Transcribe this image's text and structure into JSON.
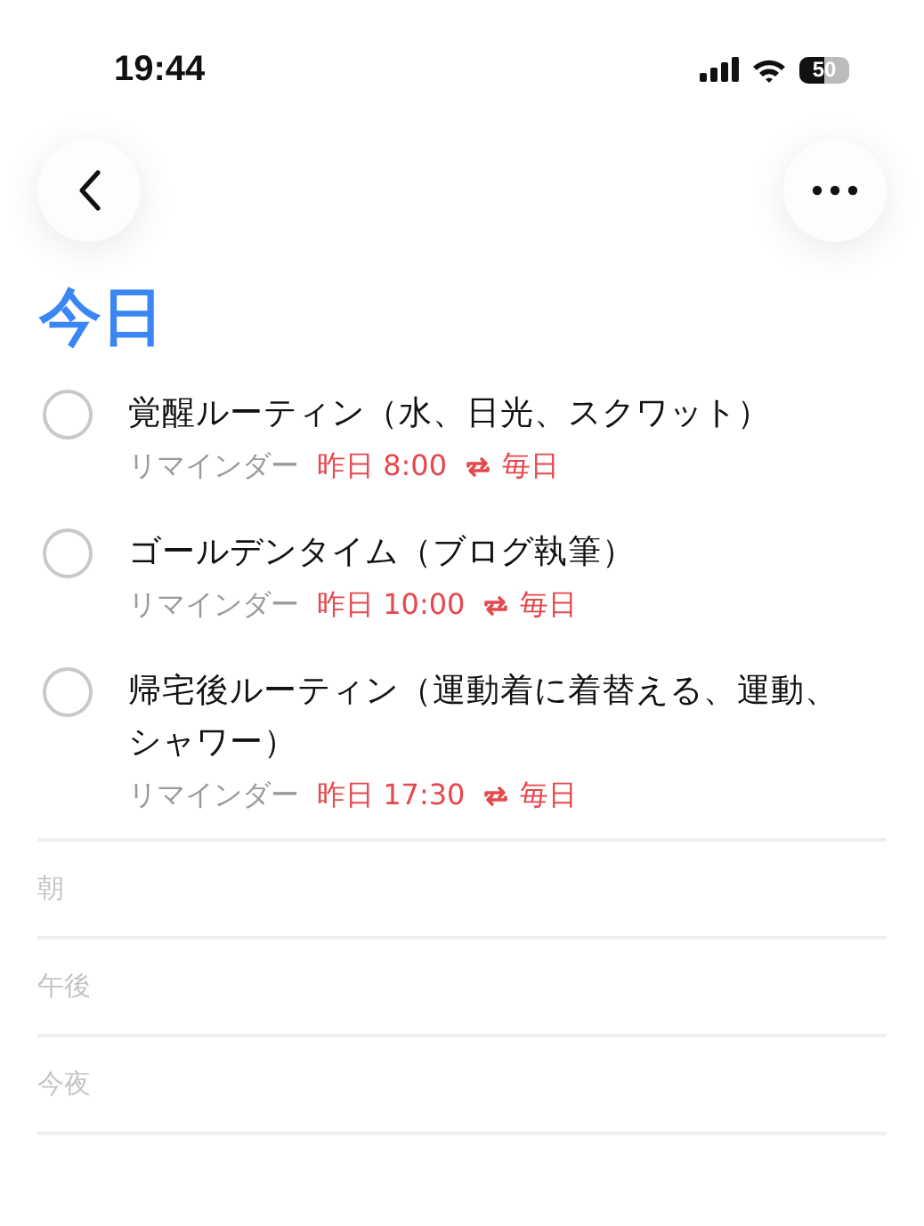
{
  "status_bar": {
    "time": "19:44",
    "battery": "50"
  },
  "title": "今日",
  "reminders": [
    {
      "title": "覚醒ルーティン（水、日光、スクワット）",
      "completed": false,
      "label": "リマインダー",
      "when": "昨日 8:00",
      "repeat": "毎日"
    },
    {
      "title": "ゴールデンタイム（ブログ執筆）",
      "completed": false,
      "label": "リマインダー",
      "when": "昨日 10:00",
      "repeat": "毎日"
    },
    {
      "title": "帰宅後ルーティン（運動着に着替える、運動、シャワー）",
      "completed": false,
      "label": "リマインダー",
      "when": "昨日 17:30",
      "repeat": "毎日"
    }
  ],
  "sections": [
    "朝",
    "午後",
    "今夜"
  ]
}
